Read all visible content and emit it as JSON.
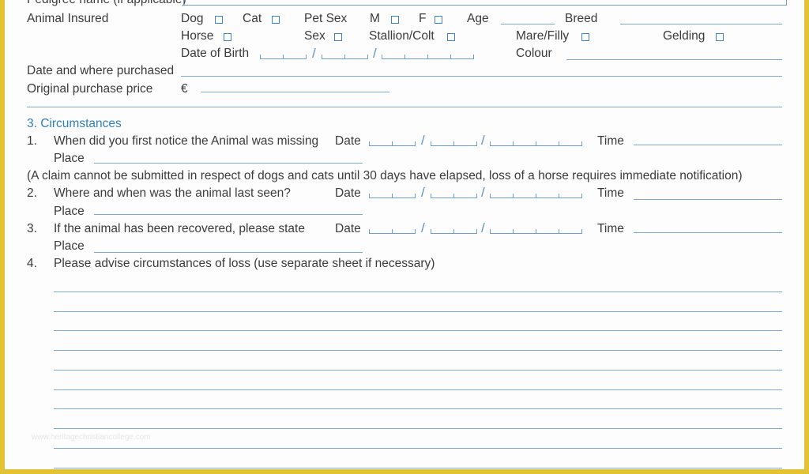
{
  "document": {
    "pedigree_label": "Pedigree name (if applicable)",
    "animal_insured_label": "Animal Insured",
    "options": {
      "dog": "Dog",
      "cat": "Cat",
      "pet_sex": "Pet Sex",
      "m": "M",
      "f": "F",
      "age": "Age",
      "breed": "Breed",
      "horse": "Horse",
      "sex": "Sex",
      "stallion_colt": "Stallion/Colt",
      "mare_filly": "Mare/Filly",
      "gelding": "Gelding",
      "date_of_birth": "Date of Birth",
      "colour": "Colour"
    },
    "date_where_purchased_label": "Date and where purchased",
    "original_price_label": "Original purchase price",
    "currency_symbol": "€",
    "date_separator": "/",
    "section3": {
      "heading": "3.  Circumstances",
      "q1_num": "1.",
      "q1_text": "When did you first notice the Animal was missing",
      "note": "(A claim cannot be submitted in respect of dogs and cats until 30 days have elapsed, loss of a horse requires immediate notification)",
      "q2_num": "2.",
      "q2_text": "Where and when was the animal last seen?",
      "q3_num": "3.",
      "q3_text": "If the animal has been recovered, please state",
      "q4_num": "4.",
      "q4_text": "Please advise circumstances of loss (use separate sheet if necessary)",
      "date_label": "Date",
      "time_label": "Time",
      "place_label": "Place"
    },
    "watermark": "www.heritagechristiancollege.com"
  },
  "colors": {
    "accent": "#2f7fbf",
    "line": "#7aaad6",
    "frame": "#e2c233"
  }
}
